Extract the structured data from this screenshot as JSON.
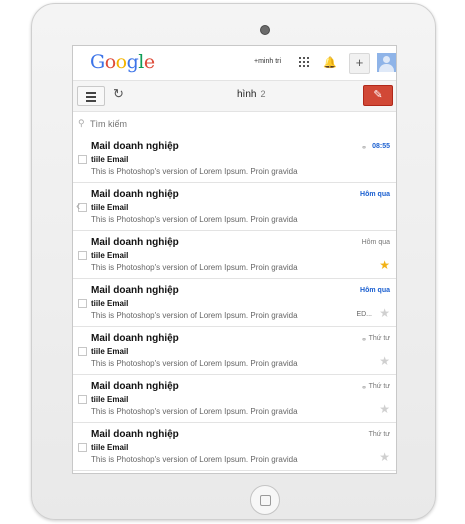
{
  "topbar": {
    "logo": [
      "G",
      "o",
      "o",
      "g",
      "l",
      "e"
    ],
    "logo_colors": [
      "#3b73e8",
      "#dd4b39",
      "#f4b400",
      "#3b73e8",
      "#0f9d58",
      "#dd4b39"
    ],
    "user_label": "+minh tri"
  },
  "toolbar": {
    "folder_label": "hình",
    "folder_count": "2",
    "compose_icon": "pencil-icon"
  },
  "search": {
    "placeholder": "Tìm kiếm"
  },
  "emails": [
    {
      "sender": "Mail doanh nghiệp",
      "subject": "tiile Email",
      "snippet": "This is Photoshop's version  of Lorem Ipsum. Proin gravida",
      "date": "08:55",
      "unread_date": true,
      "starred": null,
      "attachment": true
    },
    {
      "sender": "Mail doanh nghiệp",
      "subject": "tiile Email",
      "snippet": "This is Photoshop's version  of Lorem Ipsum. Proin gravida",
      "date": "Hôm qua",
      "unread_date": true,
      "starred": null,
      "attachment": false
    },
    {
      "sender": "Mail doanh nghiệp",
      "subject": "tiile Email",
      "snippet": "This is Photoshop's version  of Lorem Ipsum. Proin gravida",
      "date": "Hôm qua",
      "unread_date": false,
      "starred": true,
      "attachment": false
    },
    {
      "sender": "Mail doanh nghiệp",
      "subject": "tiile Email",
      "snippet": "This is Photoshop's version  of Lorem Ipsum. Proin gravida",
      "date": "Hôm qua",
      "unread_date": true,
      "starred": false,
      "attachment": false,
      "extra": "ED..."
    },
    {
      "sender": "Mail doanh nghiệp",
      "subject": "tiile Email",
      "snippet": "This is Photoshop's version  of Lorem Ipsum. Proin gravida",
      "date": "Thứ tư",
      "unread_date": false,
      "starred": false,
      "attachment": true
    },
    {
      "sender": "Mail doanh nghiệp",
      "subject": "tiile Email",
      "snippet": "This is Photoshop's version  of Lorem Ipsum. Proin gravida",
      "date": "Thứ tư",
      "unread_date": false,
      "starred": false,
      "attachment": true
    },
    {
      "sender": "Mail doanh nghiệp",
      "subject": "tiile Email",
      "snippet": "This is Photoshop's version  of Lorem Ipsum. Proin gravida",
      "date": "Thứ tư",
      "unread_date": false,
      "starred": false,
      "attachment": false
    }
  ]
}
